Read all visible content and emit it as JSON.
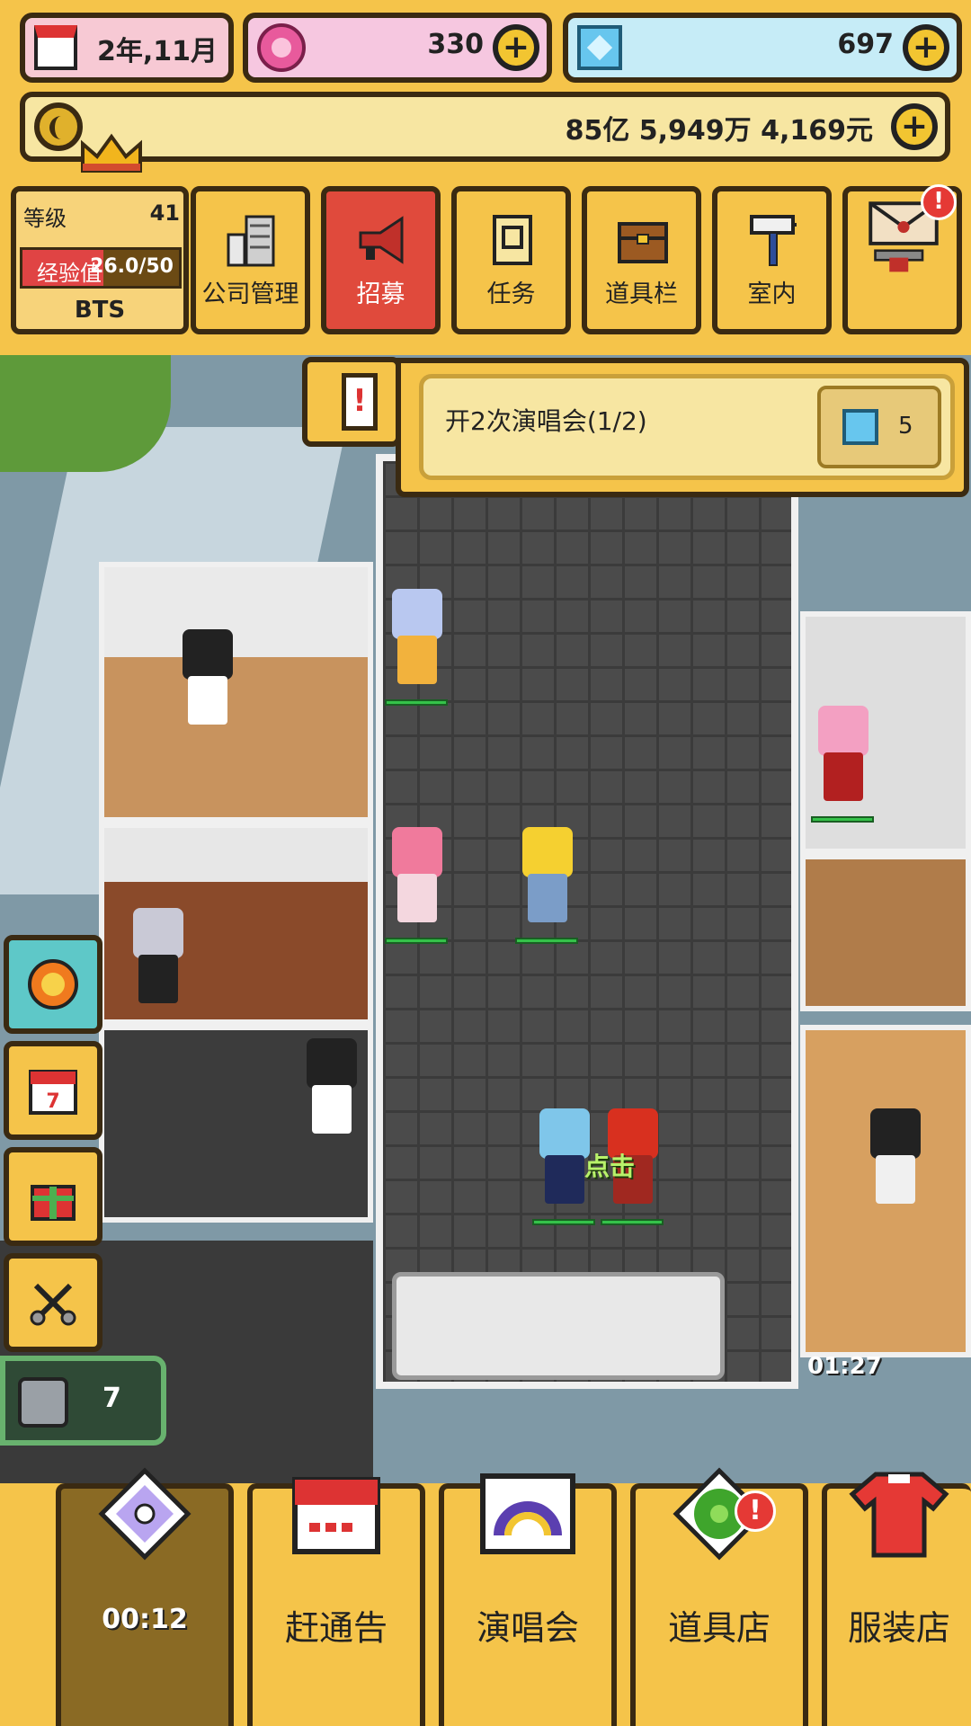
{
  "topbar": {
    "date": "2年,11月",
    "pink_gems": "330",
    "blue_gems": "697",
    "money": "85亿 5,949万 4,169元"
  },
  "level": {
    "label": "等级",
    "value": "41",
    "exp_label": "经验值",
    "exp_value": "26.0/50",
    "exp_fraction": 0.52,
    "team": "BTS"
  },
  "menu": [
    {
      "label": "公司管理",
      "icon": "building-icon"
    },
    {
      "label": "招募",
      "icon": "megaphone-icon",
      "active": true
    },
    {
      "label": "任务",
      "icon": "scroll-icon"
    },
    {
      "label": "道具栏",
      "icon": "chest-icon"
    },
    {
      "label": "室内",
      "icon": "paint-roller-icon"
    },
    {
      "label": "",
      "icon": "mail-hammer-icon",
      "badge": "!"
    }
  ],
  "quest": {
    "text": "开2次演唱会(1/2)",
    "reward": "5"
  },
  "game": {
    "tap_label": "点击",
    "timer": "01:27",
    "count": "7"
  },
  "side_buttons": [
    {
      "icon": "explosion-icon"
    },
    {
      "icon": "calendar-icon"
    },
    {
      "icon": "gift-icon"
    },
    {
      "icon": "scissors-icon"
    }
  ],
  "bottom_nav": [
    {
      "label": "",
      "timer": "00:12",
      "icon": "disc-icon"
    },
    {
      "label": "赶通告",
      "icon": "schedule-icon"
    },
    {
      "label": "演唱会",
      "icon": "stage-icon"
    },
    {
      "label": "道具店",
      "icon": "clover-icon",
      "badge": "!"
    },
    {
      "label": "服装店",
      "icon": "shirt-icon"
    }
  ],
  "colors": {
    "panel": "#f5c44a",
    "border": "#3a2a12",
    "active_red": "#e04a3c",
    "pink_gem": "#e85a9c",
    "blue_gem": "#67c6ee"
  }
}
